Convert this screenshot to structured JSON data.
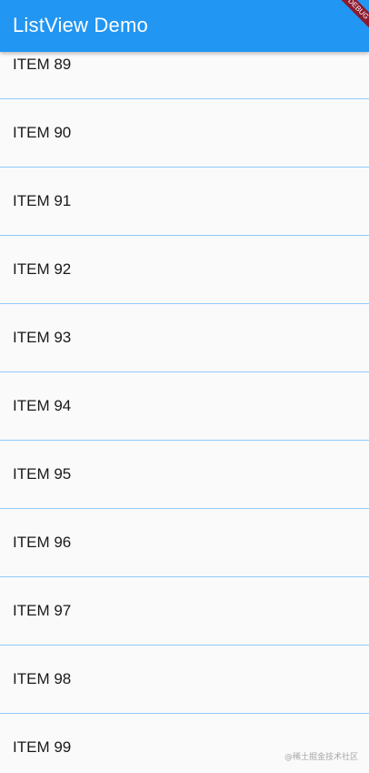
{
  "app_bar": {
    "title": "ListView Demo",
    "debug_banner": "DEBUG",
    "color": "#2196f3"
  },
  "list": {
    "divider_color": "#90caf9",
    "items": [
      {
        "label": "ITEM 89"
      },
      {
        "label": "ITEM 90"
      },
      {
        "label": "ITEM 91"
      },
      {
        "label": "ITEM 92"
      },
      {
        "label": "ITEM 93"
      },
      {
        "label": "ITEM 94"
      },
      {
        "label": "ITEM 95"
      },
      {
        "label": "ITEM 96"
      },
      {
        "label": "ITEM 97"
      },
      {
        "label": "ITEM 98"
      },
      {
        "label": "ITEM 99"
      }
    ]
  },
  "watermark": "@稀土掘金技术社区"
}
